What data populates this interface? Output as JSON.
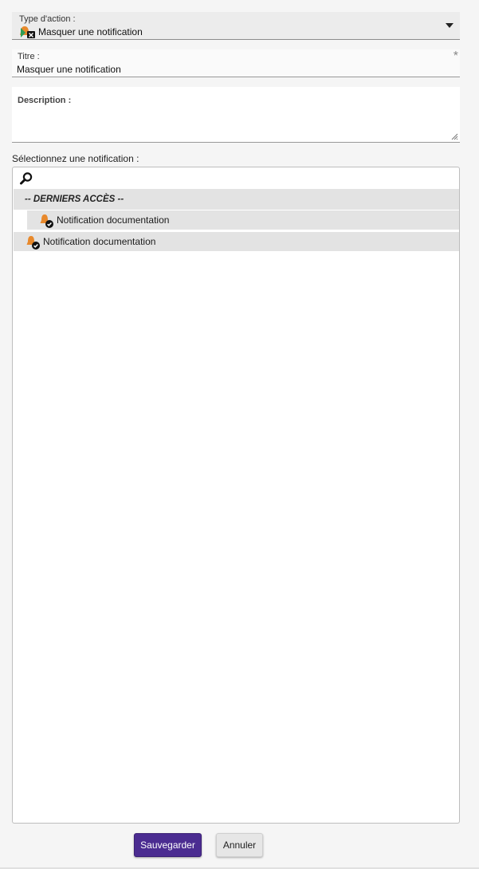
{
  "action_type": {
    "label": "Type d'action :",
    "value": "Masquer une notification",
    "icon": "hide-notification-icon"
  },
  "title": {
    "label": "Titre :",
    "value": "Masquer une notification",
    "required_mark": "*"
  },
  "description": {
    "label": "Description :",
    "value": ""
  },
  "notification_select": {
    "label": "Sélectionnez une notification :",
    "search_placeholder": "",
    "group_header": "-- DERNIERS ACCÈS --",
    "recent_items": [
      {
        "label": "Notification documentation",
        "icon": "notification-bell-check-icon"
      }
    ],
    "items": [
      {
        "label": "Notification documentation",
        "icon": "notification-bell-check-icon"
      }
    ]
  },
  "buttons": {
    "save": "Sauvegarder",
    "cancel": "Annuler"
  },
  "colors": {
    "primary": "#4b2c91",
    "bell_orange": "#e8892c"
  }
}
